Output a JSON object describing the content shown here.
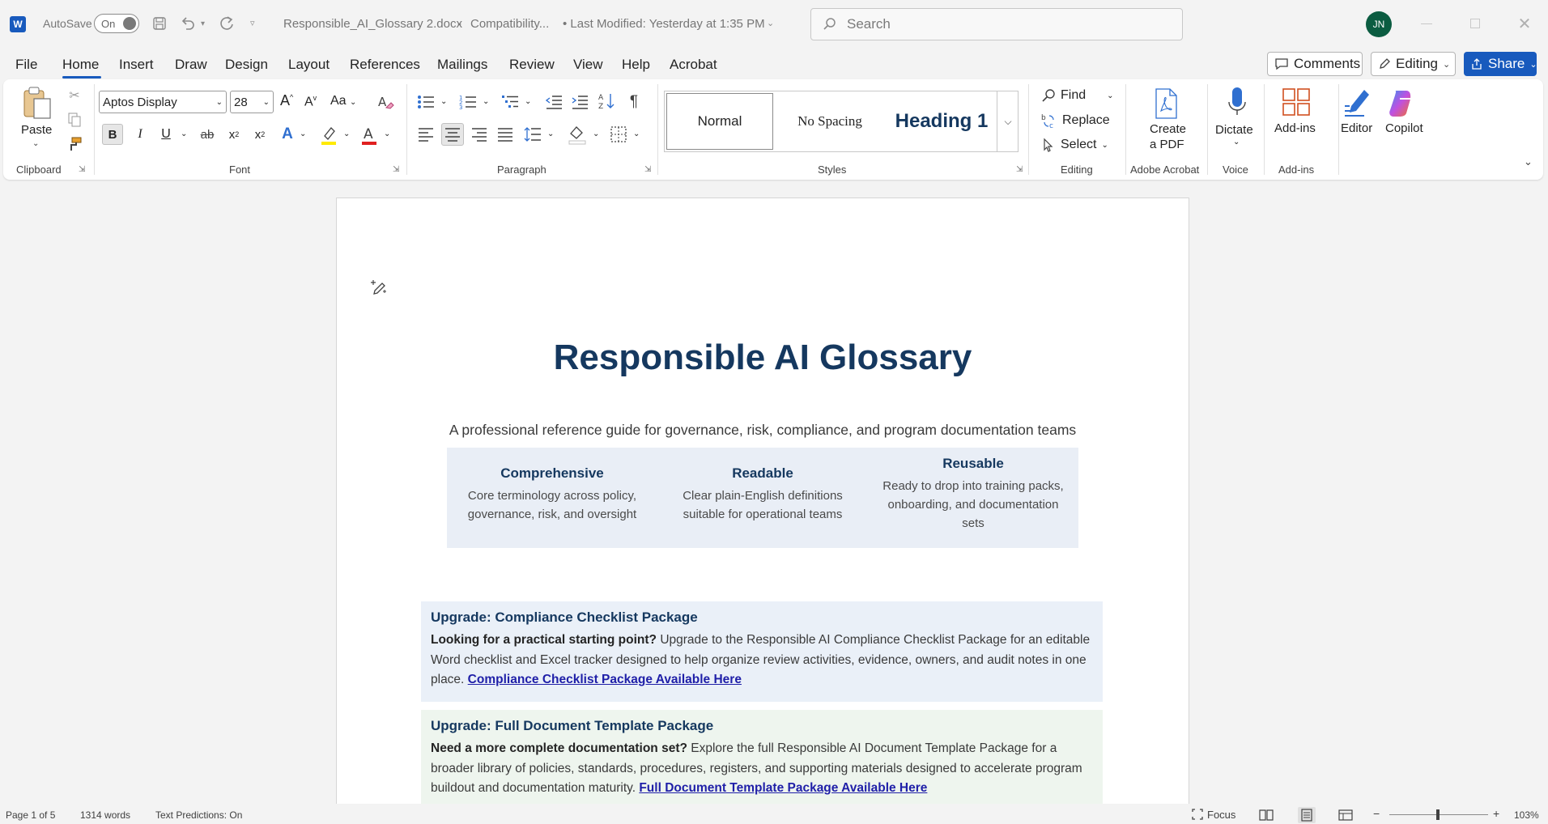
{
  "titlebar": {
    "app_icon": "word-icon",
    "autosave_label": "AutoSave",
    "autosave_state": "On",
    "doc_name": "Responsible_AI_Glossary 2.docx",
    "separator": "-",
    "compat": "Compatibility...",
    "modified": "• Last Modified: Yesterday at 1:35 PM",
    "search_placeholder": "Search",
    "user_initials": "JN"
  },
  "tabs": [
    {
      "label": "File"
    },
    {
      "label": "Home",
      "active": true
    },
    {
      "label": "Insert"
    },
    {
      "label": "Draw"
    },
    {
      "label": "Design"
    },
    {
      "label": "Layout"
    },
    {
      "label": "References"
    },
    {
      "label": "Mailings"
    },
    {
      "label": "Review"
    },
    {
      "label": "View"
    },
    {
      "label": "Help"
    },
    {
      "label": "Acrobat"
    }
  ],
  "right_buttons": {
    "comments": "Comments",
    "editing": "Editing",
    "share": "Share"
  },
  "ribbon": {
    "clipboard": {
      "paste": "Paste",
      "label": "Clipboard"
    },
    "font": {
      "name": "Aptos Display",
      "size": "28",
      "label": "Font",
      "case_btn": "Aa",
      "grow": "A",
      "shrink": "A"
    },
    "paragraph": {
      "label": "Paragraph"
    },
    "styles": {
      "items": [
        "Normal",
        "No Spacing",
        "Heading 1"
      ],
      "label": "Styles"
    },
    "editing": {
      "find": "Find",
      "replace": "Replace",
      "select": "Select",
      "label": "Editing"
    },
    "acrobat": {
      "create_line1": "Create",
      "create_line2": "a PDF",
      "label": "Adobe Acrobat"
    },
    "voice": {
      "dictate": "Dictate",
      "label": "Voice"
    },
    "addins": {
      "addins": "Add-ins",
      "label": "Add-ins"
    },
    "editor": "Editor",
    "copilot": "Copilot"
  },
  "document": {
    "title": "Responsible AI Glossary",
    "subtitle": "A professional reference guide for governance, risk, compliance, and program documentation teams",
    "features": [
      {
        "heading": "Comprehensive",
        "line1": "Core terminology across policy,",
        "line2": "governance, risk, and oversight"
      },
      {
        "heading": "Readable",
        "line1": "Clear plain-English definitions",
        "line2": "suitable for operational teams"
      },
      {
        "heading": "Reusable",
        "line1": "Ready to drop into training packs,",
        "line2": "onboarding, and documentation",
        "line3": "sets"
      }
    ],
    "upgrades": [
      {
        "heading": "Upgrade: Compliance Checklist Package",
        "lead": "Looking for a practical starting point?",
        "body": " Upgrade to the Responsible AI Compliance Checklist Package for an editable Word checklist and Excel tracker designed to help organize review activities, evidence, owners, and audit notes in one place. ",
        "link": "Compliance Checklist Package Available Here",
        "bg": "#eaf0f8"
      },
      {
        "heading": "Upgrade: Full Document Template Package",
        "lead": "Need a more complete documentation set?",
        "body": " Explore the full Responsible AI Document Template Package for a broader library of policies, standards, procedures, registers, and supporting materials designed to accelerate program buildout and documentation maturity. ",
        "link": "Full Document Template Package Available Here",
        "bg": "#eef5ee"
      }
    ]
  },
  "status": {
    "page": "Page 1 of 5",
    "words": "1314 words",
    "predictions": "Text Predictions: On",
    "focus": "Focus",
    "zoom": "103%",
    "zoom_minus": "−",
    "zoom_plus": "+"
  }
}
